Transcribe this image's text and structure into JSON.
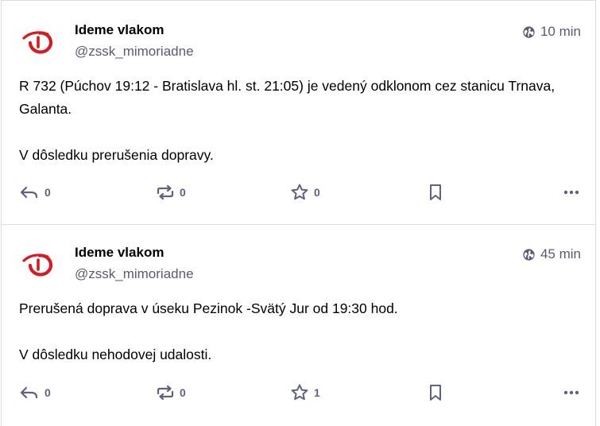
{
  "colors": {
    "border": "#dcdbe3",
    "secondary_text": "#5a5976",
    "icon": "#606085",
    "avatar_red": "#d71920"
  },
  "posts": [
    {
      "display_name": "Ideme vlakom",
      "handle": "@zssk_mimoriadne",
      "timestamp": "10 min",
      "visibility_icon": "globe-icon",
      "paragraphs": [
        "R 732 (Púchov 19:12 - Bratislava hl. st. 21:05) je vedený odklonom cez stanicu Trnava, Galanta.",
        "V dôsledku prerušenia dopravy."
      ],
      "actions": {
        "reply_count": "0",
        "boost_count": "0",
        "favourite_count": "0"
      }
    },
    {
      "display_name": "Ideme vlakom",
      "handle": "@zssk_mimoriadne",
      "timestamp": "45 min",
      "visibility_icon": "globe-icon",
      "paragraphs": [
        "Prerušená doprava v úseku Pezinok -Svätý Jur od 19:30 hod.",
        "V dôsledku nehodovej udalosti."
      ],
      "actions": {
        "reply_count": "0",
        "boost_count": "0",
        "favourite_count": "1"
      }
    }
  ]
}
